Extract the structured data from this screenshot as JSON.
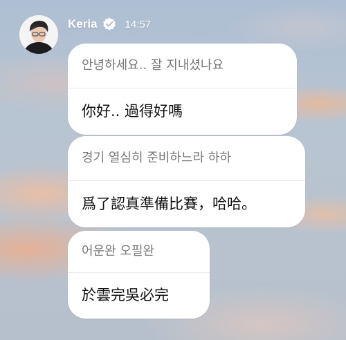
{
  "header": {
    "username": "Keria",
    "time": "14:57",
    "verified_icon": "verified-badge-icon",
    "avatar_icon": "profile-avatar"
  },
  "messages": [
    {
      "korean": "안녕하세요.. 잘 지내셨나요",
      "chinese": "你好.. 過得好嗎"
    },
    {
      "korean": "경기 열심히 준비하느라 하하",
      "chinese": "爲了認真準備比賽，哈哈。"
    },
    {
      "korean": "어운완 오필완",
      "chinese": "於雲完吳必完"
    }
  ],
  "colors": {
    "bubble": "#ffffff",
    "korean_text": "#777777",
    "chinese_text": "#111111",
    "header_text": "#ffffff",
    "sky": "#b7c4d2"
  }
}
